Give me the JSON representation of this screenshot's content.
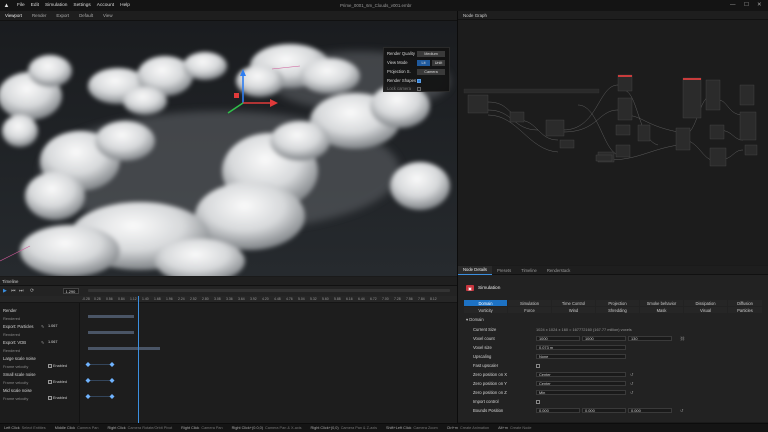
{
  "app": {
    "title": "Prime_0001_6m_Clouds_v001.embr",
    "logo_icon": "app-logo-icon",
    "menu": [
      "File",
      "Edit",
      "Simulation",
      "Settings",
      "Account",
      "Help"
    ],
    "window_controls": [
      "—",
      "☐",
      "✕"
    ]
  },
  "viewport_toolbar": {
    "items": [
      "Viewport",
      "Render",
      "Export",
      "Default",
      "View"
    ]
  },
  "viewport_overlay": {
    "rows": [
      {
        "label": "Render Quality",
        "value": "Medium"
      },
      {
        "label": "View Mode",
        "options": [
          "Lit",
          "Unlit"
        ],
        "selected": "Lit"
      },
      {
        "label": "Projection S.",
        "value": "Camera"
      },
      {
        "label": "Render Shapes",
        "checked": true
      },
      {
        "label": "Lock camera",
        "checked": false
      }
    ]
  },
  "node_graph": {
    "title": "Node Graph"
  },
  "timeline": {
    "title": "Timeline",
    "frame_value": "1.290",
    "ruler": [
      "-0.28",
      "0.28",
      "0.56",
      "0.84",
      "1.12",
      "1.40",
      "1.68",
      "1.96",
      "2.24",
      "2.52",
      "2.80",
      "3.08",
      "3.36",
      "3.64",
      "3.92",
      "4.20",
      "4.48",
      "4.76",
      "5.04",
      "5.32",
      "5.60",
      "5.88",
      "6.16",
      "6.44",
      "6.72",
      "7.00",
      "7.28",
      "7.56",
      "7.84",
      "8.12"
    ],
    "rows": [
      {
        "name": "Render",
        "type": "header"
      },
      {
        "name": "Rendered",
        "type": "sub"
      },
      {
        "name": "Export: Particles",
        "type": "header",
        "value": "1.067"
      },
      {
        "name": "Rendered",
        "type": "sub"
      },
      {
        "name": "Export: VDB",
        "type": "header",
        "value": "1.067"
      },
      {
        "name": "Rendered",
        "type": "sub"
      },
      {
        "name": "Large scale noise",
        "type": "header"
      },
      {
        "name": "Frame velocity",
        "type": "sub",
        "enabled_label": "Enabled"
      },
      {
        "name": "Small scale noise",
        "type": "header"
      },
      {
        "name": "Frame velocity",
        "type": "sub",
        "enabled_label": "Enabled"
      },
      {
        "name": "Mid scale noise",
        "type": "header"
      },
      {
        "name": "Frame velocity",
        "type": "sub",
        "enabled_label": "Enabled"
      }
    ]
  },
  "tabs": [
    "Node Details",
    "Presets",
    "Timeline",
    "Renderstack"
  ],
  "properties": {
    "title": "Simulation",
    "categories_row1": [
      "Domain",
      "Simulation",
      "Time Control",
      "Projection",
      "Smoke behavior",
      "Dissipation",
      "Diffusion"
    ],
    "categories_row2": [
      "Vorticity",
      "Force",
      "Wind",
      "Shredding",
      "Mask",
      "Visual",
      "Particles"
    ],
    "active_category": "Domain",
    "section": "Domain",
    "rows": [
      {
        "label": "Current Size",
        "text": "1024 x 1024 x 160 = 167772160 (167.77 million) voxels"
      },
      {
        "label": "Voxel count",
        "fields": [
          "1000",
          "1000",
          "130"
        ]
      },
      {
        "label": "Voxel size",
        "fields": [
          "0.073 m"
        ]
      },
      {
        "label": "Upscaling",
        "dropdown": "None"
      },
      {
        "label": "Fast upscaler",
        "checkbox": false
      },
      {
        "label": "Zero position on X",
        "dropdown": "Center"
      },
      {
        "label": "Zero position on Y",
        "dropdown": "Center"
      },
      {
        "label": "Zero position on Z",
        "dropdown": "Min"
      },
      {
        "label": "Import control",
        "checkbox": false
      },
      {
        "label": "Bounds Position",
        "fields": [
          "0.000",
          "0.000",
          "0.000"
        ]
      }
    ]
  },
  "statusbar": [
    {
      "key": "Left Click",
      "text": "Select Entities"
    },
    {
      "key": "Middle Click",
      "text": "Camera Pan"
    },
    {
      "key": "Right Click",
      "text": "Camera Rotate/Orbit Pivot"
    },
    {
      "key": "Right Click",
      "text": "Camera Pan"
    },
    {
      "key": "Right Click+(0.0,0)",
      "text": "Camera Pan & X-axis"
    },
    {
      "key": "Right Click+(0,0)",
      "text": "Camera Pan & Z-axis"
    },
    {
      "key": "Shift+Left Click",
      "text": "Camera Zoom"
    },
    {
      "key": "Ctrl+m",
      "text": "Create Animation"
    },
    {
      "key": "Alt+m",
      "text": "Create Node"
    }
  ]
}
